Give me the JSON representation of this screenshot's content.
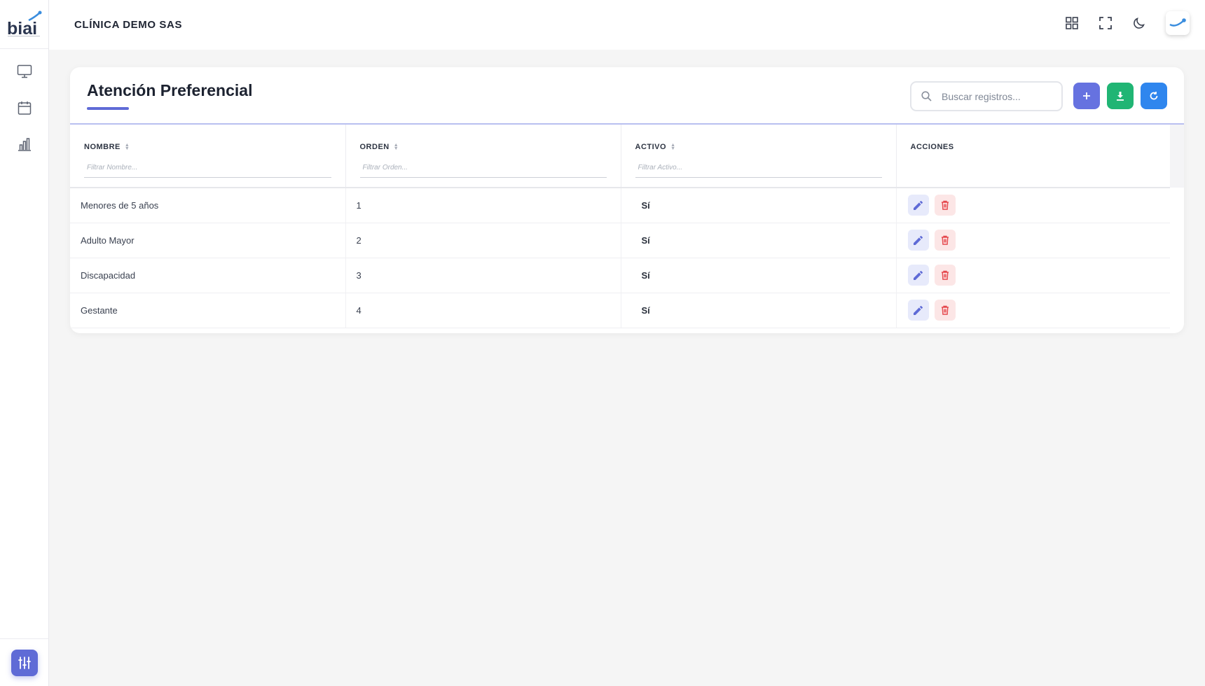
{
  "app": {
    "logo_text": "biai",
    "company": "CLÍNICA DEMO SAS"
  },
  "sidebar": {
    "items": [
      {
        "icon": "monitor-icon"
      },
      {
        "icon": "calendar-icon"
      },
      {
        "icon": "bar-chart-icon"
      }
    ],
    "bottom_icon": "sliders-icon"
  },
  "topbar": {
    "icons": [
      "grid-icon",
      "fullscreen-icon",
      "moon-icon",
      "user-avatar"
    ]
  },
  "page": {
    "title": "Atención Preferencial",
    "search_placeholder": "Buscar registros...",
    "actions": [
      "plus-icon",
      "download-icon",
      "refresh-icon"
    ]
  },
  "table": {
    "columns": [
      {
        "label": "NOMBRE",
        "filter_placeholder": "Filtrar Nombre..."
      },
      {
        "label": "ORDEN",
        "filter_placeholder": "Filtrar Orden..."
      },
      {
        "label": "ACTIVO",
        "filter_placeholder": "Filtrar Activo..."
      },
      {
        "label": "ACCIONES"
      }
    ],
    "rows": [
      {
        "nombre": "Menores de 5 años",
        "orden": "1",
        "activo": "Sí"
      },
      {
        "nombre": "Adulto Mayor",
        "orden": "2",
        "activo": "Sí"
      },
      {
        "nombre": "Discapacidad",
        "orden": "3",
        "activo": "Sí"
      },
      {
        "nombre": "Gestante",
        "orden": "4",
        "activo": "Sí"
      }
    ]
  },
  "colors": {
    "accent": "#5f6bd6",
    "add": "#6672e0",
    "download": "#20b574",
    "refresh": "#2f86ee",
    "delete": "#e5484d"
  }
}
